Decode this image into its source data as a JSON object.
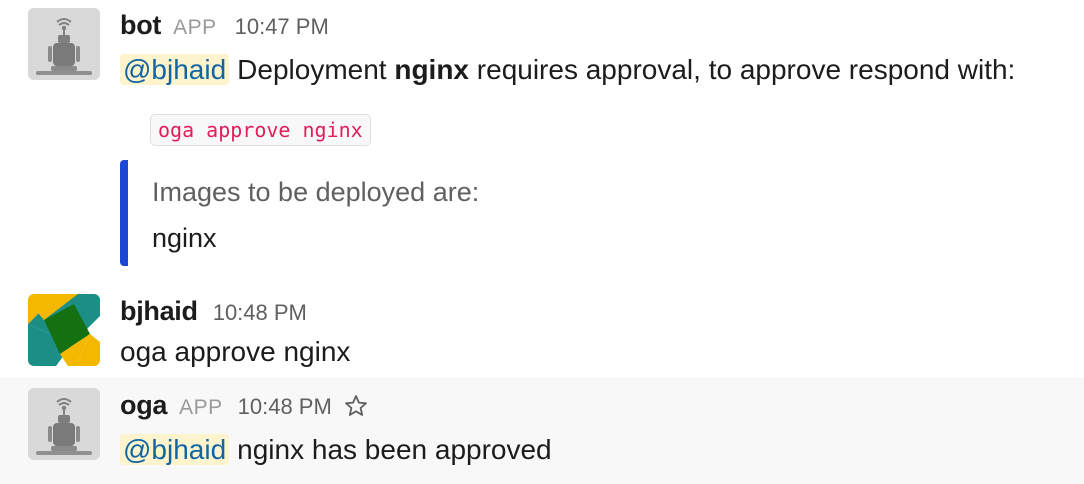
{
  "messages": [
    {
      "author": "bot",
      "app_badge": "APP",
      "time": "10:47 PM",
      "mention": "@bjhaid",
      "text_before_bold": "Deployment",
      "bold": "nginx",
      "text_after_bold": "requires approval, to approve respond with:",
      "code": "oga approve nginx",
      "attachment": {
        "pretext": "Images to be deployed are:",
        "body": "nginx",
        "color": "#1d48d3"
      }
    },
    {
      "author": "bjhaid",
      "time": "10:48 PM",
      "text": "oga approve nginx"
    },
    {
      "author": "oga",
      "app_badge": "APP",
      "time": "10:48 PM",
      "mention": "@bjhaid",
      "text": "nginx has been approved"
    }
  ],
  "colors": {
    "mention_bg": "#fdf3cc",
    "mention_text": "#1264a3",
    "code_text": "#e01e5a",
    "attachment_bar": "#1d48d3",
    "hover_bg": "#f8f8f8"
  },
  "icons": {
    "bot_avatar": "robot-icon",
    "user_avatar": "identicon",
    "star": "star-outline-icon"
  }
}
